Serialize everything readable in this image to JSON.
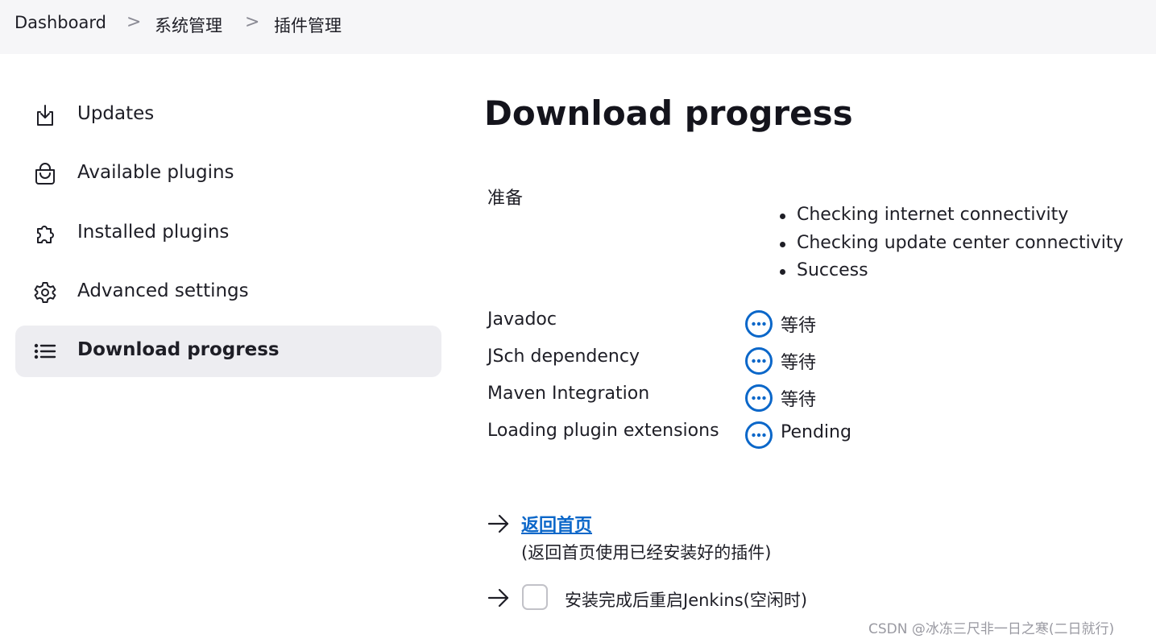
{
  "breadcrumb": {
    "items": [
      "Dashboard",
      "系统管理",
      "插件管理"
    ],
    "separator": ">"
  },
  "sidebar": {
    "items": [
      {
        "label": "Updates",
        "icon": "download-icon",
        "active": false
      },
      {
        "label": "Available plugins",
        "icon": "shopping-bag-icon",
        "active": false
      },
      {
        "label": "Installed plugins",
        "icon": "puzzle-icon",
        "active": false
      },
      {
        "label": "Advanced settings",
        "icon": "gear-icon",
        "active": false
      },
      {
        "label": "Download progress",
        "icon": "list-icon",
        "active": true
      }
    ]
  },
  "main": {
    "title": "Download progress",
    "preparation": {
      "label": "准备",
      "steps": [
        "Checking internet connectivity",
        "Checking update center connectivity",
        "Success"
      ]
    },
    "plugins": [
      {
        "name": "Javadoc",
        "status": "等待",
        "icon": "pending-icon"
      },
      {
        "name": "JSch dependency",
        "status": "等待",
        "icon": "pending-icon"
      },
      {
        "name": "Maven Integration",
        "status": "等待",
        "icon": "pending-icon"
      },
      {
        "name": "Loading plugin extensions",
        "status": "Pending",
        "icon": "pending-icon"
      }
    ],
    "go_home_link": "返回首页",
    "go_home_desc": "(返回首页使用已经安装好的插件)",
    "restart_label": "安装完成后重启Jenkins(空闲时)",
    "restart_checked": false
  },
  "watermark": "CSDN @冰冻三尺非一日之寒(二日就行)",
  "colors": {
    "accent": "#0b67c9",
    "topbar_bg": "#f6f6f8",
    "active_item_bg": "#ededf1"
  }
}
